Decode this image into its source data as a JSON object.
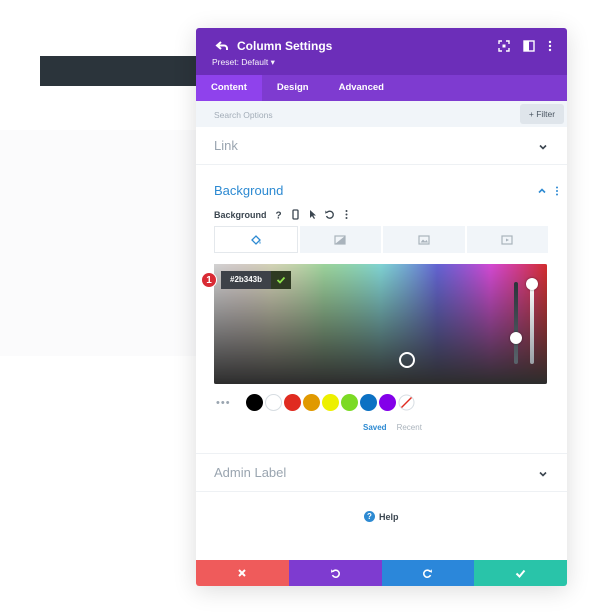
{
  "panel": {
    "title": "Column Settings",
    "preset": "Preset: Default ▾",
    "colors": {
      "header": "#6c2eb9",
      "tabs": "#7e3bd0",
      "active_tab": "#8f42ec"
    }
  },
  "tabs": [
    {
      "label": "Content",
      "active": true
    },
    {
      "label": "Design",
      "active": false
    },
    {
      "label": "Advanced",
      "active": false
    }
  ],
  "search": {
    "placeholder": "Search Options",
    "filter_label": "+ Filter"
  },
  "sections": {
    "link": {
      "title": "Link",
      "expanded": false
    },
    "background": {
      "title": "Background",
      "expanded": true,
      "field_label": "Background",
      "type_tabs": [
        "paint-bucket-icon",
        "gradient-icon",
        "image-icon",
        "video-icon"
      ],
      "active_type": 0,
      "color_picker": {
        "hex_value": "#2b343b",
        "marker_number": "1",
        "swatches": [
          "#000000",
          "#ffffff",
          "#e02b20",
          "#e09900",
          "#edf000",
          "#7cda24",
          "#0c71c3",
          "#8300e9"
        ],
        "saved_label": "Saved",
        "recent_label": "Recent"
      }
    },
    "admin_label": {
      "title": "Admin Label",
      "expanded": false
    }
  },
  "help": {
    "label": "Help"
  },
  "footer": {
    "buttons": [
      {
        "icon": "close-icon",
        "color": "#ef5b5b"
      },
      {
        "icon": "undo-icon",
        "color": "#7e3bd0"
      },
      {
        "icon": "redo-icon",
        "color": "#2b87da"
      },
      {
        "icon": "check-icon",
        "color": "#29c4a9"
      }
    ]
  },
  "canvas": {
    "column_bar_color": "#2b343b"
  }
}
